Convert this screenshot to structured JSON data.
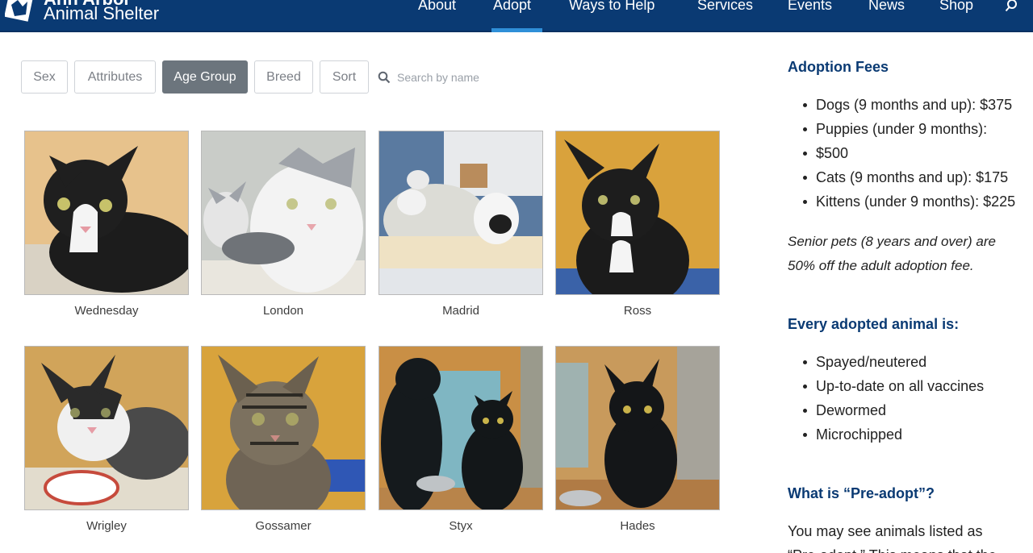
{
  "header": {
    "brand_top": "Ann Arbor",
    "brand_bottom": "Animal Shelter",
    "nav": [
      {
        "label": "About"
      },
      {
        "label": "Adopt"
      },
      {
        "label": "Ways to Help"
      },
      {
        "label": "Services"
      },
      {
        "label": "Events"
      },
      {
        "label": "News"
      },
      {
        "label": "Shop"
      }
    ],
    "active_nav": "Adopt"
  },
  "filters": {
    "buttons": [
      {
        "label": "Sex"
      },
      {
        "label": "Attributes"
      },
      {
        "label": "Age Group"
      },
      {
        "label": "Breed"
      },
      {
        "label": "Sort"
      }
    ],
    "active": "Age Group",
    "search_placeholder": "Search by name"
  },
  "pets": [
    {
      "name": "Wednesday"
    },
    {
      "name": "London"
    },
    {
      "name": "Madrid"
    },
    {
      "name": "Ross"
    },
    {
      "name": "Wrigley"
    },
    {
      "name": "Gossamer"
    },
    {
      "name": "Styx"
    },
    {
      "name": "Hades"
    }
  ],
  "sidebar": {
    "fees_title": "Adoption Fees",
    "fees": [
      "Dogs (9 months and up): $375",
      "Puppies (under 9 months):",
      "$500",
      "Cats (9 months and up): $175",
      "Kittens (under 9 months): $225"
    ],
    "senior_note_1": "Senior pets (8 years and over) are",
    "senior_note_2": "50% off the adult adoption fee.",
    "every_title": "Every adopted animal is:",
    "every_items": [
      "Spayed/neutered",
      "Up-to-date on all vaccines",
      "Dewormed",
      "Microchipped"
    ],
    "preadopt_title": "What is “Pre-adopt”?",
    "preadopt_text_1": "You may see animals listed as",
    "preadopt_text_2": "“Pre-adopt.” This means that the"
  },
  "colors": {
    "header_bg": "#0a3a73",
    "nav_active_underline": "#2f8fd8",
    "filter_active_bg": "#6c757d",
    "sidebar_heading": "#0a3a73"
  }
}
